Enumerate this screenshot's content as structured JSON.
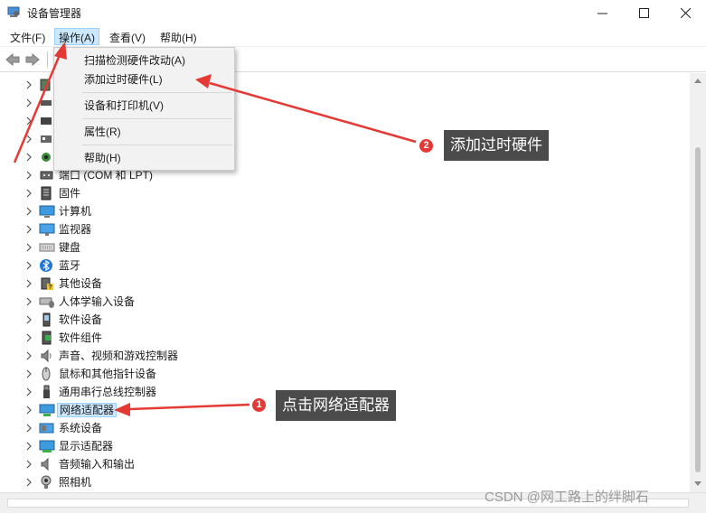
{
  "window": {
    "title": "设备管理器",
    "buttons": [
      "minimize-icon",
      "maximize-icon",
      "close-icon"
    ]
  },
  "menubar": {
    "items": [
      {
        "label": "文件(F)",
        "active": false
      },
      {
        "label": "操作(A)",
        "active": true
      },
      {
        "label": "查看(V)",
        "active": false
      },
      {
        "label": "帮助(H)",
        "active": false
      }
    ]
  },
  "toolbar": {
    "icons": [
      "back-arrow-icon",
      "forward-arrow-icon"
    ]
  },
  "action_menu": {
    "items": [
      {
        "label": "扫描检测硬件改动(A)"
      },
      {
        "label": "添加过时硬件(L)"
      },
      {
        "label": "设备和打印机(V)"
      },
      {
        "label": "属性(R)"
      },
      {
        "label": "帮助(H)"
      }
    ]
  },
  "tree": {
    "items": [
      {
        "label": "",
        "icon": "hidden-device-icon"
      },
      {
        "label": "",
        "icon": "hidden-device-icon"
      },
      {
        "label": "",
        "icon": "hidden-device-icon"
      },
      {
        "label": "",
        "icon": "hidden-device-icon"
      },
      {
        "label": "",
        "icon": "hidden-device-icon"
      },
      {
        "label": "端口 (COM 和 LPT)",
        "icon": "port-icon"
      },
      {
        "label": "固件",
        "icon": "firmware-icon"
      },
      {
        "label": "计算机",
        "icon": "computer-icon"
      },
      {
        "label": "监视器",
        "icon": "monitor-icon"
      },
      {
        "label": "键盘",
        "icon": "keyboard-icon"
      },
      {
        "label": "蓝牙",
        "icon": "bluetooth-icon"
      },
      {
        "label": "其他设备",
        "icon": "other-devices-icon"
      },
      {
        "label": "人体学输入设备",
        "icon": "hid-icon"
      },
      {
        "label": "软件设备",
        "icon": "software-device-icon"
      },
      {
        "label": "软件组件",
        "icon": "software-component-icon"
      },
      {
        "label": "声音、视频和游戏控制器",
        "icon": "speaker-icon"
      },
      {
        "label": "鼠标和其他指针设备",
        "icon": "mouse-icon"
      },
      {
        "label": "通用串行总线控制器",
        "icon": "usb-icon"
      },
      {
        "label": "网络适配器",
        "icon": "network-adapter-icon",
        "selected": true
      },
      {
        "label": "系统设备",
        "icon": "system-device-icon"
      },
      {
        "label": "显示适配器",
        "icon": "display-adapter-icon"
      },
      {
        "label": "音频输入和输出",
        "icon": "audio-io-icon"
      },
      {
        "label": "照相机",
        "icon": "camera-icon"
      }
    ]
  },
  "annotations": {
    "step1": {
      "number": "1",
      "text": "点击网络适配器"
    },
    "step2": {
      "number": "2",
      "text": "添加过时硬件"
    },
    "arrow_color": "#e53935"
  },
  "watermark": "CSDN @网工路上的绊脚石",
  "colors": {
    "selection_bg": "#cce8ff",
    "selection_border": "#99d1ff",
    "callout_bg": "#4b4b4b",
    "badge_red": "#e53935"
  }
}
